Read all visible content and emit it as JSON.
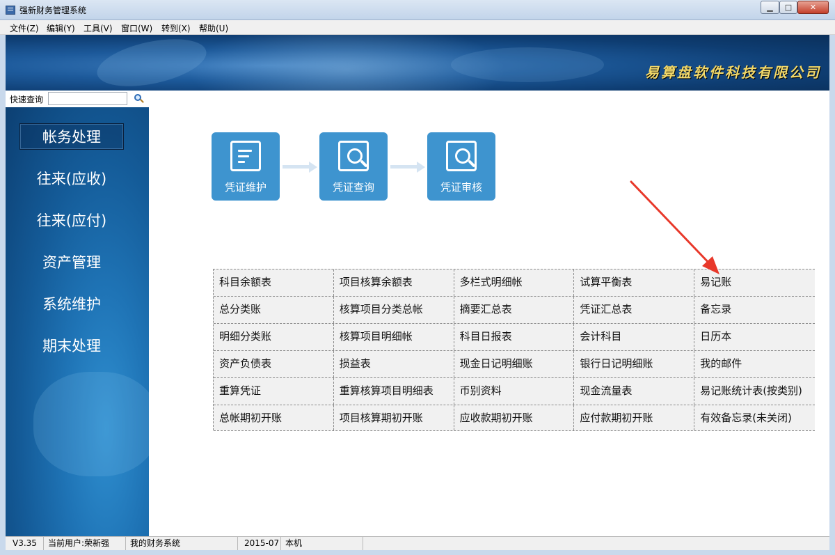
{
  "window": {
    "title": "强新财务管理系统",
    "min_glyph": "▁",
    "max_glyph": "□",
    "close_glyph": "✕"
  },
  "menu": [
    {
      "label": "文件(Z)"
    },
    {
      "label": "编辑(Y)"
    },
    {
      "label": "工具(V)"
    },
    {
      "label": "窗口(W)"
    },
    {
      "label": "转到(X)"
    },
    {
      "label": "帮助(U)"
    }
  ],
  "banner": {
    "company": "易算盘软件科技有限公司"
  },
  "quick_search": {
    "label": "快速查询",
    "value": ""
  },
  "sidebar": {
    "items": [
      {
        "label": "帐务处理",
        "active": true
      },
      {
        "label": "往来(应收)"
      },
      {
        "label": "往来(应付)"
      },
      {
        "label": "资产管理"
      },
      {
        "label": "系统维护"
      },
      {
        "label": "期末处理"
      }
    ]
  },
  "workflow": [
    {
      "label": "凭证维护",
      "icon": "document-edit-icon"
    },
    {
      "label": "凭证查询",
      "icon": "document-search-icon"
    },
    {
      "label": "凭证审核",
      "icon": "document-audit-icon"
    }
  ],
  "grid": [
    [
      "科目余额表",
      "项目核算余额表",
      "多栏式明细帐",
      "试算平衡表",
      "易记账"
    ],
    [
      "总分类账",
      "核算项目分类总帐",
      "摘要汇总表",
      "凭证汇总表",
      "备忘录"
    ],
    [
      "明细分类账",
      "核算项目明细帐",
      "科目日报表",
      "会计科目",
      "日历本"
    ],
    [
      "资产负债表",
      "损益表",
      "现金日记明细账",
      "银行日记明细账",
      "我的邮件"
    ],
    [
      "重算凭证",
      "重算核算项目明细表",
      "币别资料",
      "现金流量表",
      "易记账统计表(按类别)"
    ],
    [
      "总帐期初开账",
      "项目核算期初开账",
      "应收款期初开账",
      "应付款期初开账",
      "有效备忘录(未关闭)"
    ]
  ],
  "status": {
    "version": "V3.35",
    "user": "当前用户:荣新强",
    "system": "我的财务系统",
    "period": "2015-07",
    "location": "本机"
  },
  "colors": {
    "tile": "#3e94cf",
    "annotation": "#e8382a",
    "company_text": "#f1d86a"
  }
}
